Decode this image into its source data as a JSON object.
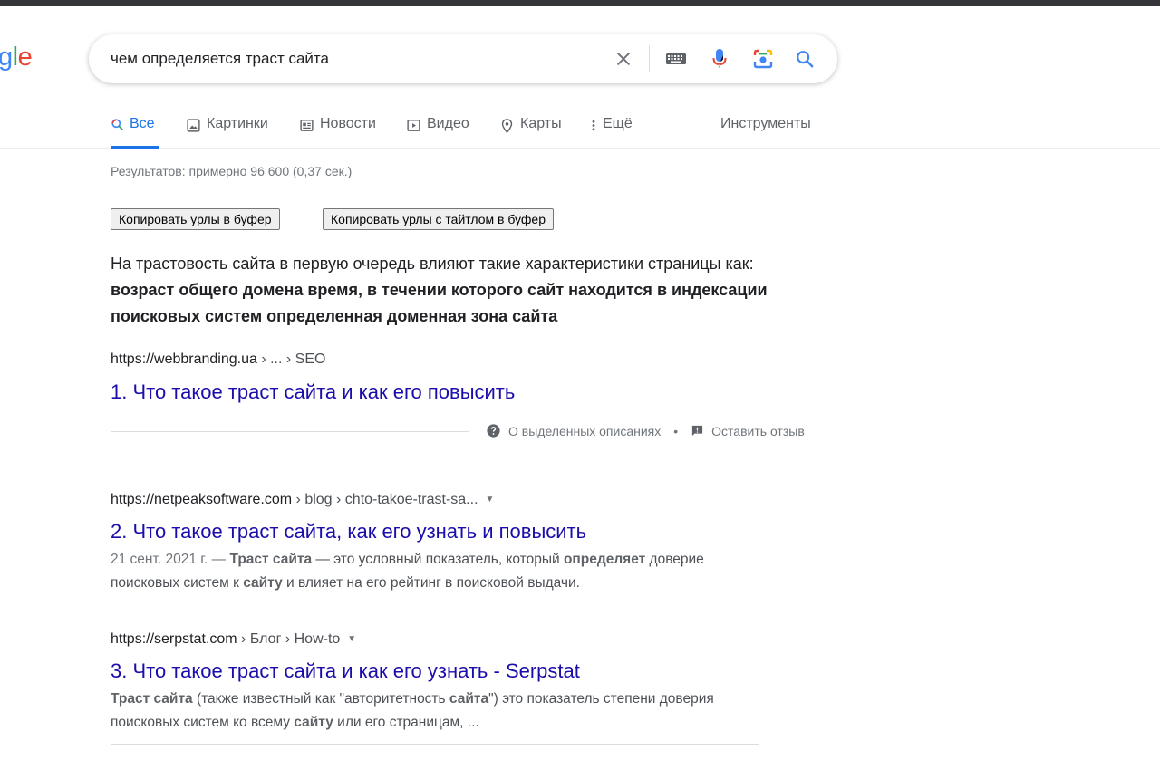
{
  "logo": {
    "partial_text": "gle"
  },
  "search": {
    "query": "чем определяется траст сайта",
    "clear_icon": "close-icon",
    "keyboard_icon": "keyboard-icon",
    "voice_icon": "microphone-icon",
    "lens_icon": "camera-icon",
    "search_icon": "search-icon"
  },
  "tabs": [
    {
      "label": "Все",
      "icon": "search-icon",
      "active": true
    },
    {
      "label": "Картинки",
      "icon": "image-icon",
      "active": false
    },
    {
      "label": "Новости",
      "icon": "news-icon",
      "active": false
    },
    {
      "label": "Видео",
      "icon": "play-icon",
      "active": false
    },
    {
      "label": "Карты",
      "icon": "map-pin-icon",
      "active": false
    },
    {
      "label": "Ещё",
      "icon": "more-vert-icon",
      "active": false
    }
  ],
  "tools_label": "Инструменты",
  "stats": "Результатов: примерно 96 600 (0,37 сек.)",
  "copy_buttons": {
    "urls": "Копировать урлы в буфер",
    "urls_titles": "Копировать урлы с тайтлом в буфер"
  },
  "featured_snippet": {
    "line1": "На трастовость сайта в первую очередь влияют такие характеристики страницы как:",
    "bold1": "возраст общего домена время, в течении которого сайт находится в индексации",
    "bold2": "поисковых систем определенная доменная зона сайта"
  },
  "results": [
    {
      "domain": "https://webbranding.ua",
      "path": " › ... › SEO",
      "title": "1. Что такое траст сайта и как его повысить"
    },
    {
      "domain": "https://netpeaksoftware.com",
      "path": " › blog › chto-takoe-trast-sa...",
      "title": "2. Что такое траст сайта, как его узнать и повысить",
      "date": "21 сент. 2021 г. — ",
      "d1": "Траст сайта",
      "d2": " — это условный показатель, который ",
      "d3": "определяет",
      "d4": " доверие поисковых систем к ",
      "d5": "сайту",
      "d6": " и влияет на его рейтинг в поисковой выдачи."
    },
    {
      "domain": "https://serpstat.com",
      "path": " › Блог › How-to",
      "title": "3. Что такое траст сайта и как его узнать - Serpstat",
      "d1": "Траст сайта",
      "d2": " (также известный как \"авторитетность ",
      "d3": "сайта",
      "d4": "\") это показатель степени доверия поисковых систем ко всему ",
      "d5": "сайту",
      "d6": " или его страницам, ..."
    }
  ],
  "feedback": {
    "about": "О выделенных описаниях",
    "separator": "•",
    "leave": "Оставить отзыв"
  },
  "colors": {
    "link": "#1a0dab",
    "accent": "#1a73e8",
    "muted": "#70757a"
  }
}
